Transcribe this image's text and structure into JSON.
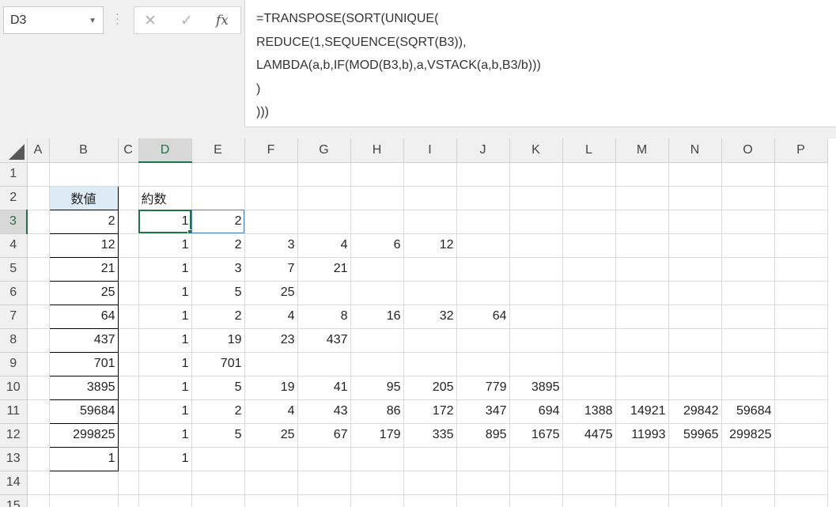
{
  "name_box": {
    "value": "D3"
  },
  "formula_bar": {
    "cancel_icon": "✕",
    "enter_icon": "✓",
    "fx_label": "fx",
    "lines": [
      "=TRANSPOSE(SORT(UNIQUE(",
      "REDUCE(1,SEQUENCE(SQRT(B3)),",
      "LAMBDA(a,b,IF(MOD(B3,b),a,VSTACK(a,b,B3/b)))",
      ")",
      ")))"
    ]
  },
  "columns": [
    "A",
    "B",
    "C",
    "D",
    "E",
    "F",
    "G",
    "H",
    "I",
    "J",
    "K",
    "L",
    "M",
    "N",
    "O",
    "P"
  ],
  "rows": [
    {
      "num": "1",
      "B": "",
      "C": "",
      "cells": []
    },
    {
      "num": "2",
      "B": "数値",
      "D_label": "約数",
      "cells": []
    },
    {
      "num": "3",
      "B": "2",
      "cells": [
        "1",
        "2"
      ]
    },
    {
      "num": "4",
      "B": "12",
      "cells": [
        "1",
        "2",
        "3",
        "4",
        "6",
        "12"
      ]
    },
    {
      "num": "5",
      "B": "21",
      "cells": [
        "1",
        "3",
        "7",
        "21"
      ]
    },
    {
      "num": "6",
      "B": "25",
      "cells": [
        "1",
        "5",
        "25"
      ]
    },
    {
      "num": "7",
      "B": "64",
      "cells": [
        "1",
        "2",
        "4",
        "8",
        "16",
        "32",
        "64"
      ]
    },
    {
      "num": "8",
      "B": "437",
      "cells": [
        "1",
        "19",
        "23",
        "437"
      ]
    },
    {
      "num": "9",
      "B": "701",
      "cells": [
        "1",
        "701"
      ]
    },
    {
      "num": "10",
      "B": "3895",
      "cells": [
        "1",
        "5",
        "19",
        "41",
        "95",
        "205",
        "779",
        "3895"
      ]
    },
    {
      "num": "11",
      "B": "59684",
      "cells": [
        "1",
        "2",
        "4",
        "43",
        "86",
        "172",
        "347",
        "694",
        "1388",
        "14921",
        "29842",
        "59684"
      ]
    },
    {
      "num": "12",
      "B": "299825",
      "cells": [
        "1",
        "5",
        "25",
        "67",
        "179",
        "335",
        "895",
        "1675",
        "4475",
        "11993",
        "59965",
        "299825"
      ]
    },
    {
      "num": "13",
      "B": "1",
      "cells": [
        "1"
      ]
    },
    {
      "num": "14",
      "B": "",
      "cells": []
    },
    {
      "num": "15",
      "B": "",
      "cells": []
    }
  ],
  "selected": {
    "col": "D",
    "row": "3"
  }
}
